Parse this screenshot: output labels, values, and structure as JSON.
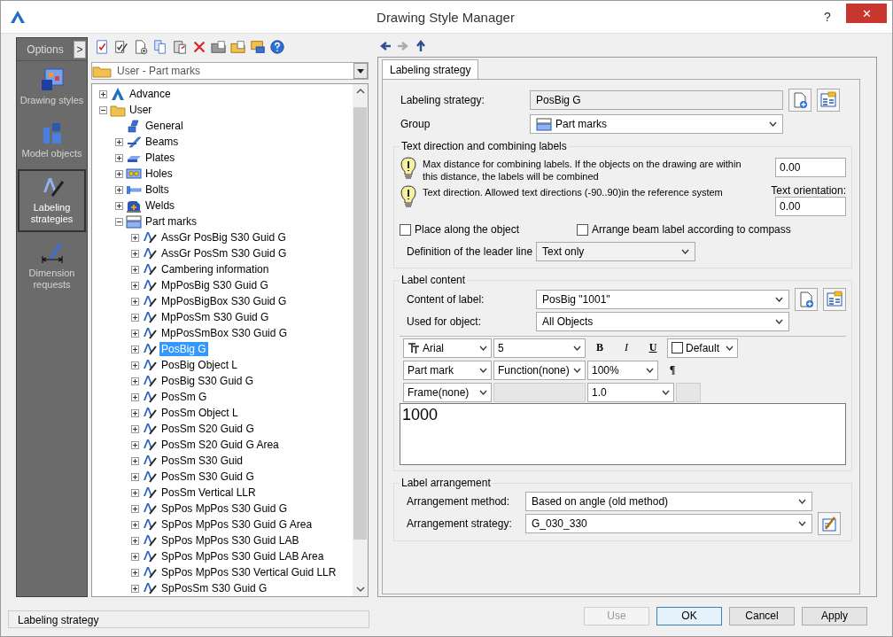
{
  "window": {
    "title": "Drawing Style Manager",
    "help": "?",
    "close": "✕"
  },
  "nav": {
    "header": "Options",
    "toggle": ">",
    "items": [
      {
        "label": "Drawing styles",
        "kind": "styles",
        "selected": false
      },
      {
        "label": "Model objects",
        "kind": "objects",
        "selected": false
      },
      {
        "label": "Labeling strategies",
        "kind": "labeling",
        "selected": true
      },
      {
        "label": "Dimension requests",
        "kind": "dimension",
        "selected": false
      }
    ]
  },
  "folder_combo": {
    "value": "User - Part marks"
  },
  "tree": [
    {
      "label": "Advance",
      "kind": "logo",
      "expanded": false,
      "selected": false
    },
    {
      "label": "User",
      "kind": "folder",
      "expanded": true,
      "selected": false,
      "children": [
        {
          "label": "General",
          "kind": "general",
          "selected": false
        },
        {
          "label": "Beams",
          "kind": "beams",
          "expanded": false,
          "selected": false
        },
        {
          "label": "Plates",
          "kind": "plates",
          "expanded": false,
          "selected": false
        },
        {
          "label": "Holes",
          "kind": "holes",
          "expanded": false,
          "selected": false
        },
        {
          "label": "Bolts",
          "kind": "bolts",
          "expanded": false,
          "selected": false
        },
        {
          "label": "Welds",
          "kind": "welds",
          "expanded": false,
          "selected": false
        },
        {
          "label": "Part marks",
          "kind": "partmarks",
          "expanded": true,
          "selected": false,
          "children": [
            {
              "label": "AssGr PosBig S30 Guid G",
              "kind": "strategy",
              "expanded": false,
              "selected": false
            },
            {
              "label": "AssGr PosSm S30 Guid G",
              "kind": "strategy",
              "expanded": false,
              "selected": false
            },
            {
              "label": "Cambering information",
              "kind": "strategy",
              "expanded": false,
              "selected": false
            },
            {
              "label": "MpPosBig S30 Guid G",
              "kind": "strategy",
              "expanded": false,
              "selected": false
            },
            {
              "label": "MpPosBigBox S30 Guid G",
              "kind": "strategy",
              "expanded": false,
              "selected": false
            },
            {
              "label": "MpPosSm S30 Guid G",
              "kind": "strategy",
              "expanded": false,
              "selected": false
            },
            {
              "label": "MpPosSmBox S30 Guid G",
              "kind": "strategy",
              "expanded": false,
              "selected": false
            },
            {
              "label": "PosBig G",
              "kind": "strategy",
              "expanded": false,
              "selected": true
            },
            {
              "label": "PosBig Object L",
              "kind": "strategy",
              "expanded": false,
              "selected": false
            },
            {
              "label": "PosBig S30 Guid G",
              "kind": "strategy",
              "expanded": false,
              "selected": false
            },
            {
              "label": "PosSm G",
              "kind": "strategy",
              "expanded": false,
              "selected": false
            },
            {
              "label": "PosSm Object L",
              "kind": "strategy",
              "expanded": false,
              "selected": false
            },
            {
              "label": "PosSm S20 Guid G",
              "kind": "strategy",
              "expanded": false,
              "selected": false
            },
            {
              "label": "PosSm S20 Guid G Area",
              "kind": "strategy",
              "expanded": false,
              "selected": false
            },
            {
              "label": "PosSm S30 Guid",
              "kind": "strategy",
              "expanded": false,
              "selected": false
            },
            {
              "label": "PosSm S30 Guid G",
              "kind": "strategy",
              "expanded": false,
              "selected": false
            },
            {
              "label": "PosSm Vertical LLR",
              "kind": "strategy",
              "expanded": false,
              "selected": false
            },
            {
              "label": "SpPos MpPos S30 Guid G",
              "kind": "strategy",
              "expanded": false,
              "selected": false
            },
            {
              "label": "SpPos MpPos S30 Guid G Area",
              "kind": "strategy",
              "expanded": false,
              "selected": false
            },
            {
              "label": "SpPos MpPos S30 Guid LAB",
              "kind": "strategy",
              "expanded": false,
              "selected": false
            },
            {
              "label": "SpPos MpPos S30 Guid LAB Area",
              "kind": "strategy",
              "expanded": false,
              "selected": false
            },
            {
              "label": "SpPos MpPos S30 Vertical Guid LLR",
              "kind": "strategy",
              "expanded": false,
              "selected": false
            },
            {
              "label": "SpPosSm S30 Guid G",
              "kind": "strategy",
              "expanded": false,
              "selected": false
            }
          ]
        }
      ]
    }
  ],
  "arrows": [
    {
      "kind": "back",
      "disabled": false
    },
    {
      "kind": "forward",
      "disabled": true
    },
    {
      "kind": "up",
      "disabled": false
    }
  ],
  "tabs": [
    {
      "label": "Labeling strategy",
      "selected": true
    }
  ],
  "form": {
    "strategy": {
      "label": "Labeling strategy:",
      "value": "PosBig G"
    },
    "group": {
      "label": "Group",
      "value": "Part marks"
    },
    "text_direction": {
      "title": "Text direction and combining labels",
      "max_distance": {
        "hint": "Max distance for combining labels. If the objects on the drawing are within this distance, the labels will be combined",
        "value": "0.00"
      },
      "orientation": {
        "hint": "Text direction. Allowed text directions (-90..90)in the reference system",
        "label": "Text orientation:",
        "value": "0.00"
      },
      "checkboxes": [
        {
          "label": "Place along the object",
          "checked": false
        },
        {
          "label": "Arrange beam label according to compass",
          "checked": false
        }
      ],
      "leader": {
        "label": "Definition of the leader line",
        "value": "Text only"
      }
    },
    "label_content": {
      "title": "Label content",
      "content": {
        "label": "Content of label:",
        "value": "PosBig \"1001\""
      },
      "used_for": {
        "label": "Used for object:",
        "value": "All Objects"
      },
      "format_rows": [
        [
          {
            "kind": "font",
            "value": "Arial"
          },
          {
            "kind": "combo",
            "value": "5"
          },
          {
            "kind": "bold",
            "value": "B"
          },
          {
            "kind": "italic",
            "value": "I"
          },
          {
            "kind": "underline",
            "value": "U"
          },
          {
            "kind": "color",
            "value": "Default"
          }
        ],
        [
          {
            "kind": "combo",
            "value": "Part mark"
          },
          {
            "kind": "combo",
            "value": "Function(none)"
          },
          {
            "kind": "combo",
            "value": "100%"
          },
          {
            "kind": "pilcrow",
            "value": "¶"
          }
        ],
        [
          {
            "kind": "combo",
            "value": "Frame(none)"
          },
          {
            "kind": "blank"
          },
          {
            "kind": "combo",
            "value": "1.0"
          },
          {
            "kind": "blank"
          }
        ]
      ],
      "text": "1000"
    },
    "arrangement": {
      "title": "Label arrangement",
      "method": {
        "label": "Arrangement method:",
        "value": "Based on angle (old method)"
      },
      "strategy": {
        "label": "Arrangement strategy:",
        "value": "G_030_330"
      }
    }
  },
  "buttons": [
    {
      "label": "Use",
      "disabled": true,
      "default": false
    },
    {
      "label": "OK",
      "disabled": false,
      "default": true
    },
    {
      "label": "Cancel",
      "disabled": false,
      "default": false
    },
    {
      "label": "Apply",
      "disabled": false,
      "default": false
    }
  ],
  "status_bar": "Labeling strategy"
}
